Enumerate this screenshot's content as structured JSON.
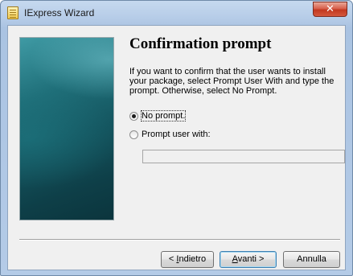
{
  "window": {
    "title": "IExpress Wizard",
    "close_glyph": "✕"
  },
  "page": {
    "heading": "Confirmation prompt",
    "description": "If you want to confirm that the user wants to install your package, select Prompt User With and type the prompt. Otherwise, select No Prompt."
  },
  "options": {
    "no_prompt": {
      "label": "No prompt.",
      "checked": true
    },
    "prompt_user": {
      "label": "Prompt user with:",
      "checked": false
    }
  },
  "prompt_field": {
    "value": ""
  },
  "buttons": {
    "back": {
      "prefix": "< ",
      "mnemonic": "I",
      "rest": "ndietro"
    },
    "next": {
      "mnemonic": "A",
      "rest": "vanti >"
    },
    "cancel": {
      "label": "Annulla"
    }
  },
  "icons": {
    "app": "iexpress-app-icon",
    "close": "close-icon"
  },
  "colors": {
    "title_bar": "#b7cde8",
    "close_button": "#c2381f",
    "side_panel": "#1f6f79",
    "dialog_background": "#f0f0f0"
  }
}
